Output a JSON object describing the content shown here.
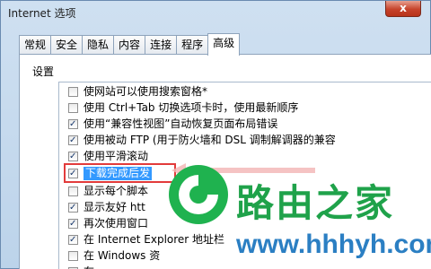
{
  "window": {
    "title": "Internet 选项",
    "close_label": "x"
  },
  "tabs": [
    {
      "label": "常规",
      "active": false
    },
    {
      "label": "安全",
      "active": false
    },
    {
      "label": "隐私",
      "active": false
    },
    {
      "label": "内容",
      "active": false
    },
    {
      "label": "连接",
      "active": false
    },
    {
      "label": "程序",
      "active": false
    },
    {
      "label": "高级",
      "active": true
    }
  ],
  "settings": {
    "section_label": "设置",
    "items": [
      {
        "label": "使网站可以使用搜索窗格*",
        "checked": false,
        "selected": false
      },
      {
        "label": "使用 Ctrl+Tab 切换选项卡时，使用最新顺序",
        "checked": false,
        "selected": false
      },
      {
        "label": "使用“兼容性视图”自动恢复页面布局错误",
        "checked": true,
        "selected": false
      },
      {
        "label": "使用被动 FTP (用于防火墙和 DSL 调制解调器的兼容",
        "checked": true,
        "selected": false
      },
      {
        "label": "使用平滑滚动",
        "checked": true,
        "selected": false
      },
      {
        "label": "下载完成后发",
        "checked": true,
        "selected": true
      },
      {
        "label": "显示每个脚本",
        "checked": false,
        "selected": false
      },
      {
        "label": "显示友好 htt",
        "checked": true,
        "selected": false
      },
      {
        "label": "再次使用窗口",
        "checked": true,
        "selected": false
      },
      {
        "label": "在 Internet Explorer 地址栏",
        "checked": true,
        "selected": false
      },
      {
        "label": "在 Windows 资",
        "checked": false,
        "selected": false
      },
      {
        "label": "在",
        "checked": false,
        "selected": false
      }
    ]
  },
  "watermark": {
    "brand": "路由之家",
    "url": "www.hhhyh.com",
    "logo_icon": "router-logo-icon",
    "color_green": "#1fb24f",
    "color_blue": "#2b7fc3"
  },
  "annotation": {
    "box_color": "#e23b3b"
  }
}
